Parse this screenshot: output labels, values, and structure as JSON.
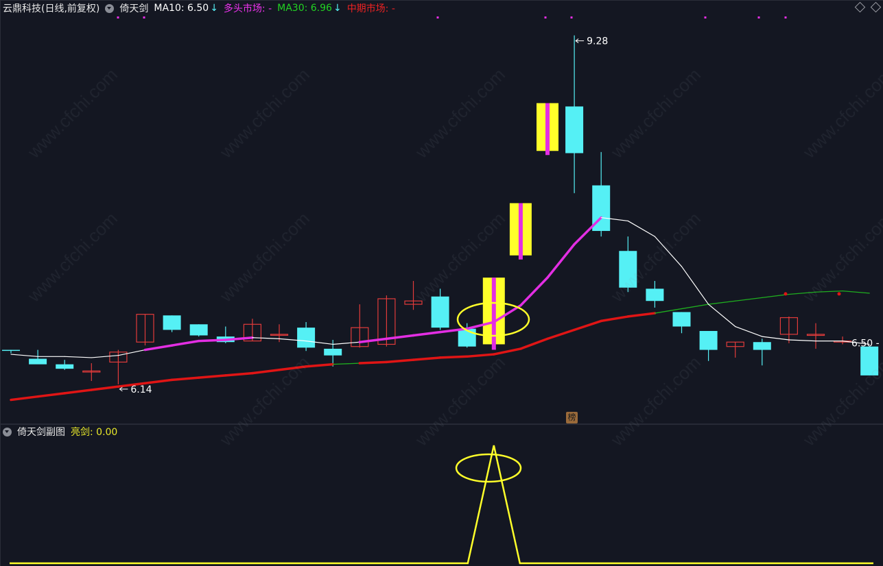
{
  "header": {
    "stock": "云鼎科技(日线,前复权)",
    "indicator": "倚天剑",
    "ma10_label": "MA10: 6.50",
    "ma10_arrow": "↓",
    "bull_label": "多头市场: -",
    "ma30_label": "MA30: 6.96",
    "ma30_arrow": "↓",
    "mid_label": "中期市场: -"
  },
  "sub_header": {
    "name": "倚天剑副图",
    "value_label": "亮剑: 0.00"
  },
  "annotations": {
    "high": "9.28",
    "low": "6.14",
    "last": "6.50 -",
    "badge": "榜"
  },
  "watermark": "www.cfchi.com",
  "colors": {
    "background": "#141722",
    "up_candle": "#e23b3b",
    "down_candle": "#55f0f5",
    "signal_candle": "#ffff2a",
    "ma_magenta": "#e32ee3",
    "ma_red": "#e01515",
    "ma_white": "#ffffff",
    "ma_green": "#1fae1f",
    "label_green": "#22d322",
    "label_magenta": "#ee33ee",
    "label_red": "#ee2222",
    "label_yellow": "#e8e82a"
  },
  "chart_data": {
    "type": "candlestick",
    "price_range": [
      5.8,
      9.45
    ],
    "candles": [
      {
        "o": 6.45,
        "h": 6.45,
        "l": 6.42,
        "c": 6.45,
        "up": false
      },
      {
        "o": 6.37,
        "h": 6.45,
        "l": 6.33,
        "c": 6.32,
        "up": false
      },
      {
        "o": 6.32,
        "h": 6.36,
        "l": 6.27,
        "c": 6.28,
        "up": false
      },
      {
        "o": 6.25,
        "h": 6.33,
        "l": 6.17,
        "c": 6.26,
        "up": true
      },
      {
        "o": 6.34,
        "h": 6.45,
        "l": 6.14,
        "c": 6.43,
        "up": true
      },
      {
        "o": 6.52,
        "h": 6.77,
        "l": 6.49,
        "c": 6.77,
        "up": true
      },
      {
        "o": 6.76,
        "h": 6.76,
        "l": 6.61,
        "c": 6.63,
        "up": false
      },
      {
        "o": 6.68,
        "h": 6.68,
        "l": 6.57,
        "c": 6.58,
        "up": false
      },
      {
        "o": 6.57,
        "h": 6.66,
        "l": 6.51,
        "c": 6.52,
        "up": false
      },
      {
        "o": 6.53,
        "h": 6.73,
        "l": 6.53,
        "c": 6.68,
        "up": true
      },
      {
        "o": 6.59,
        "h": 6.68,
        "l": 6.52,
        "c": 6.59,
        "up": true
      },
      {
        "o": 6.65,
        "h": 6.7,
        "l": 6.44,
        "c": 6.47,
        "up": false
      },
      {
        "o": 6.46,
        "h": 6.54,
        "l": 6.3,
        "c": 6.4,
        "up": false
      },
      {
        "o": 6.48,
        "h": 6.86,
        "l": 6.47,
        "c": 6.65,
        "up": true
      },
      {
        "o": 6.5,
        "h": 6.94,
        "l": 6.48,
        "c": 6.91,
        "up": true
      },
      {
        "o": 6.86,
        "h": 7.07,
        "l": 6.81,
        "c": 6.89,
        "up": true
      },
      {
        "o": 6.93,
        "h": 7.0,
        "l": 6.63,
        "c": 6.65,
        "up": false
      },
      {
        "o": 6.64,
        "h": 6.69,
        "l": 6.47,
        "c": 6.48,
        "up": false
      },
      {
        "o": 7.1,
        "h": 7.1,
        "l": 6.5,
        "c": 6.5,
        "up": false,
        "signal": true
      },
      {
        "o": 7.77,
        "h": 7.77,
        "l": 7.3,
        "c": 7.3,
        "up": false,
        "signal": true
      },
      {
        "o": 8.67,
        "h": 8.67,
        "l": 8.24,
        "c": 8.24,
        "up": false,
        "signal": true
      },
      {
        "o": 8.64,
        "h": 9.28,
        "l": 7.86,
        "c": 8.22,
        "up": false
      },
      {
        "o": 7.93,
        "h": 8.23,
        "l": 7.47,
        "c": 7.52,
        "up": false
      },
      {
        "o": 7.34,
        "h": 7.47,
        "l": 6.97,
        "c": 7.01,
        "up": false
      },
      {
        "o": 7.0,
        "h": 7.07,
        "l": 6.83,
        "c": 6.89,
        "up": false
      },
      {
        "o": 6.79,
        "h": 6.79,
        "l": 6.6,
        "c": 6.66,
        "up": false
      },
      {
        "o": 6.62,
        "h": 6.62,
        "l": 6.35,
        "c": 6.45,
        "up": false
      },
      {
        "o": 6.48,
        "h": 6.52,
        "l": 6.38,
        "c": 6.52,
        "up": true
      },
      {
        "o": 6.52,
        "h": 6.55,
        "l": 6.31,
        "c": 6.45,
        "up": false
      },
      {
        "o": 6.59,
        "h": 6.75,
        "l": 6.51,
        "c": 6.74,
        "up": true
      },
      {
        "o": 6.58,
        "h": 6.69,
        "l": 6.46,
        "c": 6.59,
        "up": true
      },
      {
        "o": 6.52,
        "h": 6.57,
        "l": 6.5,
        "c": 6.53,
        "up": true
      },
      {
        "o": 6.48,
        "h": 6.48,
        "l": 6.22,
        "c": 6.22,
        "up": false
      }
    ],
    "ma_white": [
      6.41,
      6.39,
      6.39,
      6.38,
      6.4,
      6.45,
      6.49,
      6.53,
      6.54,
      6.56,
      6.55,
      6.53,
      6.5,
      6.52,
      6.55,
      6.58,
      6.61,
      6.64,
      6.7,
      6.85,
      7.1,
      7.4,
      7.64,
      7.61,
      7.47,
      7.2,
      6.86,
      6.66,
      6.57,
      6.54,
      6.53,
      6.53,
      6.5
    ],
    "ma_red": [
      6.0,
      6.03,
      6.06,
      6.09,
      6.12,
      6.15,
      6.18,
      6.2,
      6.22,
      6.24,
      6.27,
      6.3,
      6.32,
      6.33,
      6.34,
      6.36,
      6.38,
      6.39,
      6.41,
      6.46,
      6.55,
      6.63,
      6.71,
      6.75,
      6.78,
      6.82,
      6.86,
      6.89,
      6.92,
      6.95,
      6.97,
      6.98,
      6.96
    ],
    "ma_white_segments_magenta": [
      [
        0,
        0
      ],
      [
        5,
        9
      ],
      [
        13,
        22
      ]
    ],
    "ma_red_segments_green": [
      [
        12,
        13
      ],
      [
        24,
        32
      ]
    ],
    "sub_series": {
      "name": "亮剑",
      "values": [
        0,
        0,
        0,
        0,
        0,
        0,
        0,
        0,
        0,
        0,
        0,
        0,
        0,
        0,
        0,
        0,
        0,
        0,
        1,
        0,
        0,
        0,
        0,
        0,
        0,
        0,
        0,
        0,
        0,
        0,
        0,
        0,
        0
      ],
      "range": [
        0,
        1
      ]
    }
  }
}
